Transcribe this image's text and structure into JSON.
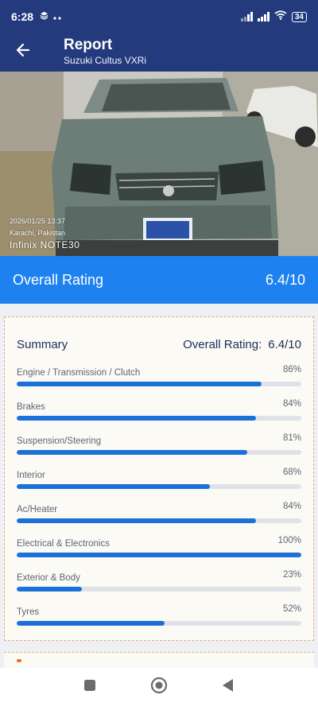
{
  "status_bar": {
    "time": "6:28",
    "battery": "34"
  },
  "header": {
    "title": "Report",
    "subtitle": "Suzuki Cultus VXRi"
  },
  "photo": {
    "stamp_date": "2026/01/25 13:37",
    "stamp_location": "Karachi, Pakistan",
    "stamp_brand": "Infinix NOTE30"
  },
  "overall": {
    "label": "Overall Rating",
    "value": "6.4/10"
  },
  "summary": {
    "title": "Summary",
    "rating_label": "Overall Rating:",
    "rating_value": "6.4/10",
    "metrics": [
      {
        "label": "Engine / Transmission / Clutch",
        "pct_text": "86%",
        "pct": 86
      },
      {
        "label": "Brakes",
        "pct_text": "84%",
        "pct": 84
      },
      {
        "label": "Suspension/Steering",
        "pct_text": "81%",
        "pct": 81
      },
      {
        "label": "Interior",
        "pct_text": "68%",
        "pct": 68
      },
      {
        "label": "Ac/Heater",
        "pct_text": "84%",
        "pct": 84
      },
      {
        "label": "Electrical & Electronics",
        "pct_text": "100%",
        "pct": 100
      },
      {
        "label": "Exterior & Body",
        "pct_text": "23%",
        "pct": 23
      },
      {
        "label": "Tyres",
        "pct_text": "52%",
        "pct": 52
      }
    ]
  },
  "nav": {
    "icons": [
      "recents-square-icon",
      "home-circle-icon",
      "back-triangle-icon"
    ]
  },
  "colors": {
    "header_bg": "#233a7d",
    "accent": "#1d82f0",
    "bar_fill": "#1c71d8"
  }
}
